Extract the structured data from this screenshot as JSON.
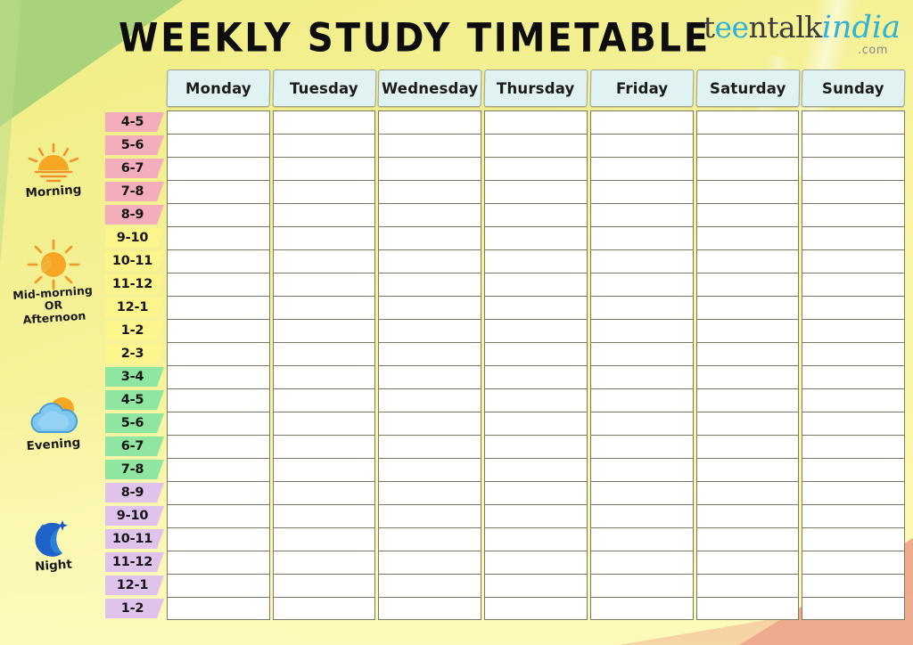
{
  "header": {
    "title": "WEEKLY  STUDY   TIMETABLE",
    "logo": {
      "part1": "t",
      "part2": "ee",
      "part3": "ntalk",
      "part4": "india",
      "part5": ".com",
      "teal_color": "#2fb2d8",
      "dark_color": "#3b3b3b"
    }
  },
  "table": {
    "days": [
      "Monday",
      "Tuesday",
      "Wednesday",
      "Thursday",
      "Friday",
      "Saturday",
      "Sunday"
    ],
    "rows": [
      {
        "time": "4-5",
        "color": "pink",
        "hex": "#f4aebb"
      },
      {
        "time": "5-6",
        "color": "pink",
        "hex": "#f4aebb"
      },
      {
        "time": "6-7",
        "color": "pink",
        "hex": "#f4aebb"
      },
      {
        "time": "7-8",
        "color": "pink",
        "hex": "#f4aebb"
      },
      {
        "time": "8-9",
        "color": "pink",
        "hex": "#f4aebb"
      },
      {
        "time": "9-10",
        "color": "yellow",
        "hex": "#fbf58c"
      },
      {
        "time": "10-11",
        "color": "yellow",
        "hex": "#fbf58c"
      },
      {
        "time": "11-12",
        "color": "yellow",
        "hex": "#fbf58c"
      },
      {
        "time": "12-1",
        "color": "yellow",
        "hex": "#fbf58c"
      },
      {
        "time": "1-2",
        "color": "yellow",
        "hex": "#fbf58c"
      },
      {
        "time": "2-3",
        "color": "yellow",
        "hex": "#fbf58c"
      },
      {
        "time": "3-4",
        "color": "green",
        "hex": "#8fe6a0"
      },
      {
        "time": "4-5",
        "color": "green",
        "hex": "#8fe6a0"
      },
      {
        "time": "5-6",
        "color": "green",
        "hex": "#8fe6a0"
      },
      {
        "time": "6-7",
        "color": "green",
        "hex": "#8fe6a0"
      },
      {
        "time": "7-8",
        "color": "green",
        "hex": "#8fe6a0"
      },
      {
        "time": "8-9",
        "color": "purple",
        "hex": "#e0c3ec"
      },
      {
        "time": "9-10",
        "color": "purple",
        "hex": "#e0c3ec"
      },
      {
        "time": "10-11",
        "color": "purple",
        "hex": "#e0c3ec"
      },
      {
        "time": "11-12",
        "color": "purple",
        "hex": "#e0c3ec"
      },
      {
        "time": "12-1",
        "color": "purple",
        "hex": "#e0c3ec"
      },
      {
        "time": "1-2",
        "color": "purple",
        "hex": "#e0c3ec"
      }
    ],
    "cell_value": ""
  },
  "periods": [
    {
      "label": "Morning",
      "icon": "sunrise-icon"
    },
    {
      "label": "Mid-morning\nOR\nAfternoon",
      "icon": "sun-icon"
    },
    {
      "label": "Evening",
      "icon": "sun-behind-cloud-icon"
    },
    {
      "label": "Night",
      "icon": "crescent-moon-icon"
    }
  ],
  "period_labels": {
    "morning": "Morning",
    "midmorning_1": "Mid-morning",
    "midmorning_2": "OR",
    "midmorning_3": "Afternoon",
    "evening": "Evening",
    "night": "Night"
  },
  "colors": {
    "background_yellow": "#f4f196",
    "background_green": "#a8d37a",
    "background_peach": "#f0a98a",
    "day_header_bg": "#e0f2f1",
    "cell_bg": "#ffffff"
  }
}
